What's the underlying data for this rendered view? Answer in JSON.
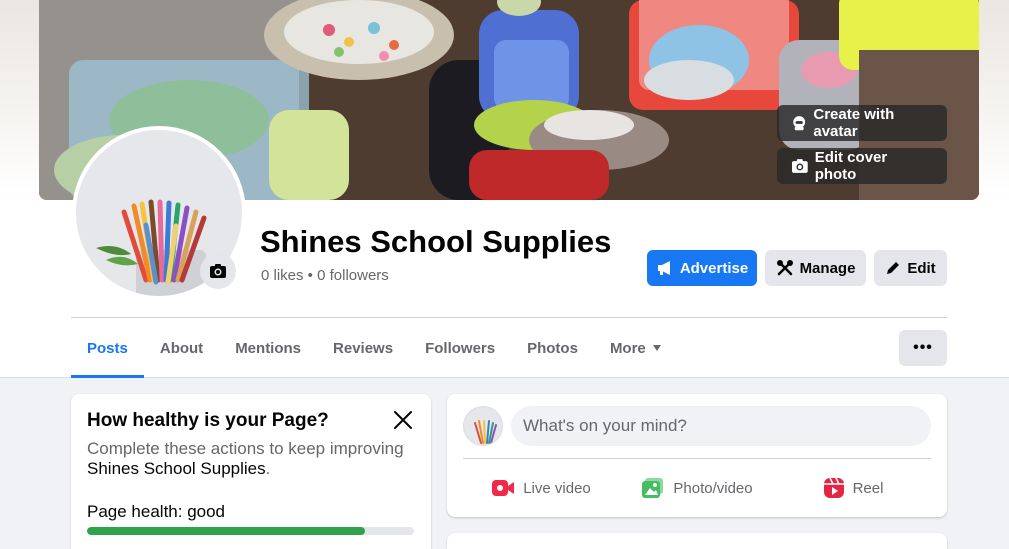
{
  "cover": {
    "create_avatar_label": "Create with avatar",
    "edit_cover_label": "Edit cover photo"
  },
  "page": {
    "name": "Shines School Supplies",
    "stats": "0 likes • 0 followers"
  },
  "actions": {
    "advertise": "Advertise",
    "manage": "Manage",
    "edit": "Edit"
  },
  "tabs": [
    {
      "label": "Posts",
      "active": true
    },
    {
      "label": "About"
    },
    {
      "label": "Mentions"
    },
    {
      "label": "Reviews"
    },
    {
      "label": "Followers"
    },
    {
      "label": "Photos"
    },
    {
      "label": "More"
    }
  ],
  "more_menu_label": "•••",
  "health": {
    "title": "How healthy is your Page?",
    "desc_prefix": "Complete these actions to keep improving",
    "desc_page": "Shines School Supplies",
    "desc_suffix": ".",
    "status_label": "Page health: good",
    "progress": 0.85
  },
  "composer": {
    "placeholder": "What's on your mind?",
    "actions": [
      {
        "label": "Live video",
        "icon": "live-video-icon"
      },
      {
        "label": "Photo/video",
        "icon": "photo-video-icon"
      },
      {
        "label": "Reel",
        "icon": "reel-icon"
      }
    ]
  },
  "colors": {
    "accent": "#1877f2",
    "health_good": "#31a24c",
    "live": "#f02849",
    "photo": "#45bd62",
    "reel": "#e42645"
  }
}
